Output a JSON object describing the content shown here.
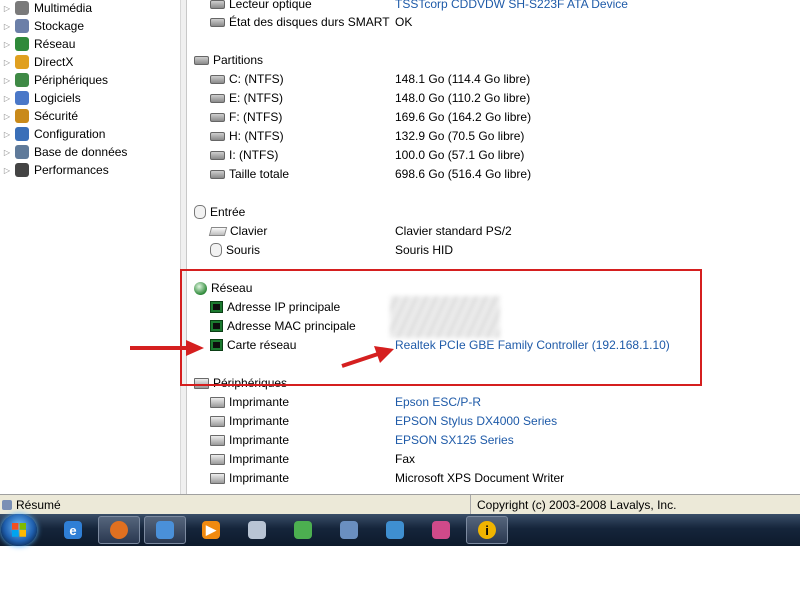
{
  "tree": {
    "items": [
      {
        "label": "Multimédia",
        "icon": "multimedia-icon",
        "color": "#7a7a7a"
      },
      {
        "label": "Stockage",
        "icon": "storage-icon",
        "color": "#6b7fa8"
      },
      {
        "label": "Réseau",
        "icon": "network-icon",
        "color": "#2f8a3a"
      },
      {
        "label": "DirectX",
        "icon": "directx-icon",
        "color": "#e0a020"
      },
      {
        "label": "Périphériques",
        "icon": "devices-icon",
        "color": "#3f8a46"
      },
      {
        "label": "Logiciels",
        "icon": "software-icon",
        "color": "#4a78c8"
      },
      {
        "label": "Sécurité",
        "icon": "shield-icon",
        "color": "#c98a1a"
      },
      {
        "label": "Configuration",
        "icon": "configuration-icon",
        "color": "#3a6fb8"
      },
      {
        "label": "Base de données",
        "icon": "database-icon",
        "color": "#5f7a9a"
      },
      {
        "label": "Performances",
        "icon": "hourglass-icon",
        "color": "#444444"
      }
    ]
  },
  "pane": {
    "top_rows": [
      {
        "label": "Lecteur optique",
        "value": "TSSTcorp CDDVDW SH-S223F ATA Device",
        "link": true
      },
      {
        "label": "État des disques durs SMART",
        "value": "OK",
        "link": false
      }
    ],
    "partitions": {
      "title": "Partitions",
      "rows": [
        {
          "label": "C: (NTFS)",
          "value": "148.1 Go (114.4 Go libre)"
        },
        {
          "label": "E: (NTFS)",
          "value": "148.0 Go (110.2 Go libre)"
        },
        {
          "label": "F: (NTFS)",
          "value": "169.6 Go (164.2 Go libre)"
        },
        {
          "label": "H: (NTFS)",
          "value": "132.9 Go (70.5 Go libre)"
        },
        {
          "label": "I: (NTFS)",
          "value": "100.0 Go (57.1 Go libre)"
        },
        {
          "label": "Taille totale",
          "value": "698.6 Go (516.4 Go libre)"
        }
      ]
    },
    "entree": {
      "title": "Entrée",
      "rows": [
        {
          "label": "Clavier",
          "value": "Clavier standard PS/2"
        },
        {
          "label": "Souris",
          "value": "Souris HID"
        }
      ]
    },
    "reseau": {
      "title": "Réseau",
      "rows": [
        {
          "label": "Adresse IP principale",
          "value": ""
        },
        {
          "label": "Adresse MAC principale",
          "value": ""
        },
        {
          "label": "Carte réseau",
          "value": "Realtek PCIe GBE Family Controller  (192.168.1.10)"
        }
      ]
    },
    "peripheriques": {
      "title": "Périphériques",
      "rows": [
        {
          "label": "Imprimante",
          "value": "Epson ESC/P-R",
          "link": true
        },
        {
          "label": "Imprimante",
          "value": "EPSON Stylus DX4000 Series",
          "link": true
        },
        {
          "label": "Imprimante",
          "value": "EPSON SX125 Series",
          "link": true
        },
        {
          "label": "Imprimante",
          "value": "Fax",
          "link": false
        },
        {
          "label": "Imprimante",
          "value": "Microsoft XPS Document Writer",
          "link": false
        }
      ]
    }
  },
  "status": {
    "left": "Résumé",
    "right": "Copyright (c) 2003-2008 Lavalys, Inc."
  },
  "taskbar": {
    "apps": [
      {
        "name": "internet-explorer-icon",
        "glyph": "e",
        "color": "#2f7fd6"
      },
      {
        "name": "firefox-icon",
        "glyph": "",
        "color": "#e07020"
      },
      {
        "name": "thunderbird-icon",
        "glyph": "",
        "color": "#4a90d9"
      },
      {
        "name": "media-player-icon",
        "glyph": "▶",
        "color": "#f08a10"
      },
      {
        "name": "calculator-icon",
        "glyph": "",
        "color": "#b8c4d4"
      },
      {
        "name": "network-tool-icon",
        "glyph": "",
        "color": "#4caf50"
      },
      {
        "name": "monitor-icon",
        "glyph": "",
        "color": "#6a8fc0"
      },
      {
        "name": "users-icon",
        "glyph": "",
        "color": "#3f8fd0"
      },
      {
        "name": "color-palette-icon",
        "glyph": "",
        "color": "#d04a8a"
      },
      {
        "name": "everest-icon",
        "glyph": "i",
        "color": "#e08a00"
      }
    ]
  },
  "colors": {
    "link": "#1e5aa8",
    "annotation": "#d51f1f"
  }
}
